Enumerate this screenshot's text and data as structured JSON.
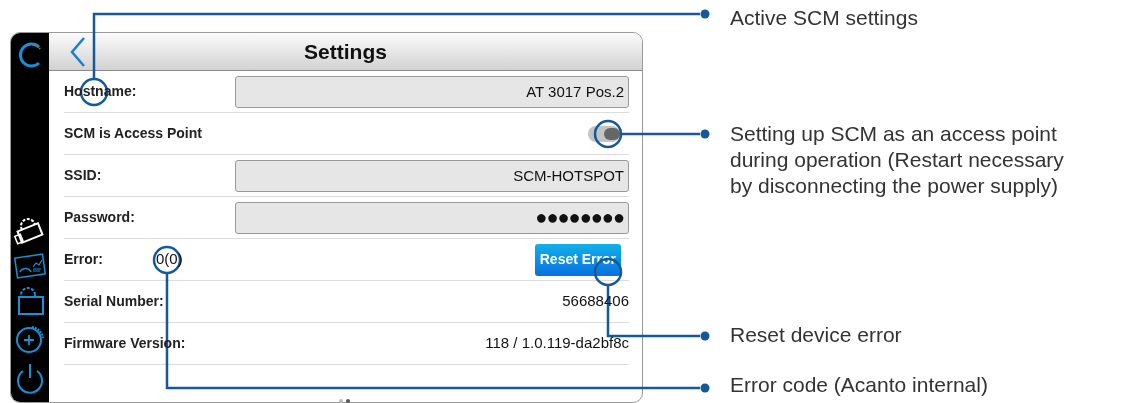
{
  "screen": {
    "title": "Settings",
    "rows": [
      {
        "kind": "input",
        "label": "Hostname:",
        "value": "AT 3017 Pos.2"
      },
      {
        "kind": "toggle",
        "label": "SCM is Access Point",
        "on": true
      },
      {
        "kind": "input",
        "label": "SSID:",
        "value": "SCM-HOTSPOT"
      },
      {
        "kind": "password",
        "label": "Password:",
        "value": "●●●●●●●●"
      },
      {
        "kind": "error",
        "label": "Error:",
        "value": "0(0)",
        "button": "Reset Error"
      },
      {
        "kind": "info",
        "label": "Serial Number:",
        "value": "56688406"
      },
      {
        "kind": "info",
        "label": "Firmware Version:",
        "value": "118 / 1.0.119-da2bf8c"
      }
    ]
  },
  "callouts": [
    {
      "text": "Active SCM settings"
    },
    {
      "text": "Setting up SCM as an access point during operation (Restart necessary by disconnecting the power supply)"
    },
    {
      "text": "Reset device error"
    },
    {
      "text": "Error code (Acanto internal)"
    }
  ]
}
